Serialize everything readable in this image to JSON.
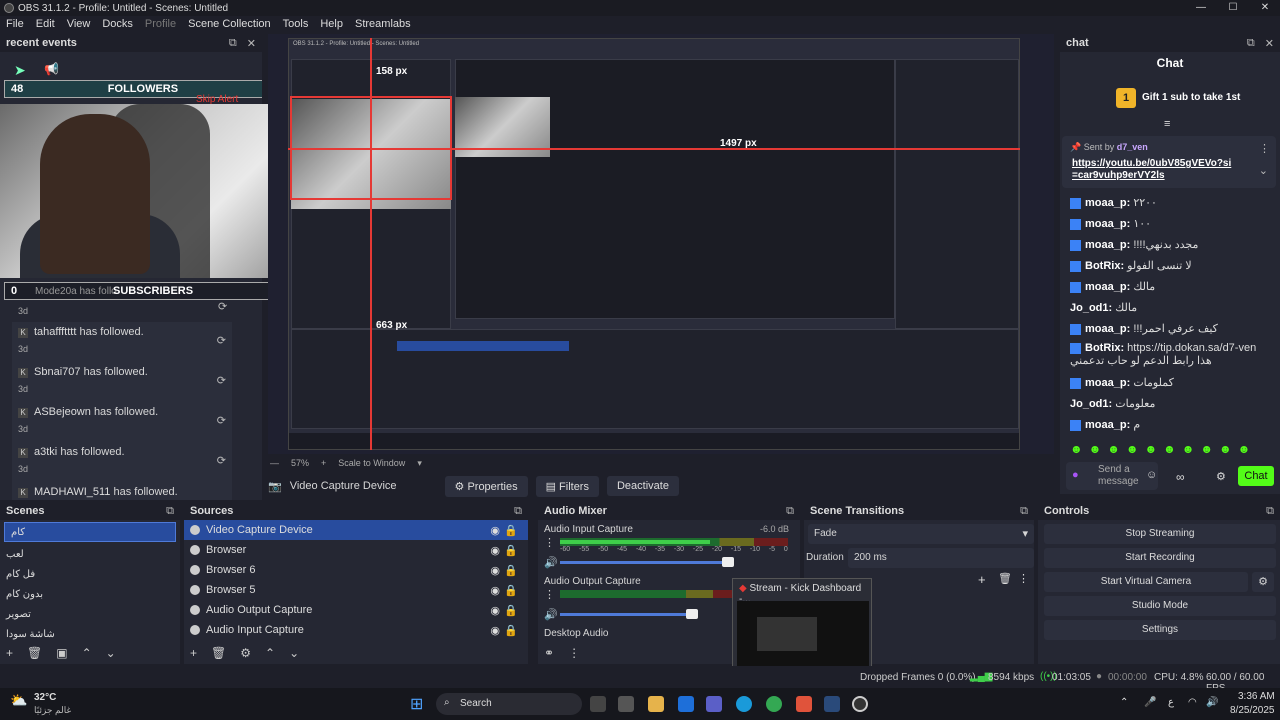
{
  "window": {
    "title": "OBS 31.1.2 - Profile: Untitled - Scenes: Untitled"
  },
  "menu": [
    "File",
    "Edit",
    "View",
    "Docks",
    "Profile",
    "Scene Collection",
    "Tools",
    "Help",
    "Streamlabs"
  ],
  "recent": {
    "title": "recent events",
    "followers_left": "48",
    "followers_label": "FOLLOWERS",
    "followers_right": "100",
    "skip_alert": "Skip Alert",
    "subs_left": "0",
    "subs_name": "Mode20a",
    "subs_partial": "has follo",
    "subs_label": "SUBSCRIBERS",
    "subs_right": "10",
    "events": [
      {
        "name": "tahaffftttt",
        "text": "has followed.",
        "when": "3d"
      },
      {
        "name": "Sbnai707",
        "text": "has followed.",
        "when": "3d"
      },
      {
        "name": "ASBejeown",
        "text": "has followed.",
        "when": "3d"
      },
      {
        "name": "a3tki",
        "text": "has followed.",
        "when": "3d"
      },
      {
        "name": "MADHAWI_511",
        "text": "has followed.",
        "when": ""
      }
    ],
    "first_when": "3d"
  },
  "preview": {
    "nested_title": "OBS 31.1.2 - Profile: Untitled - Scenes: Untitled",
    "measure_1": "158 px",
    "measure_2": "1497 px",
    "measure_3": "663 px",
    "zoom": "57%",
    "zoom_mode": "Scale to Window"
  },
  "chat": {
    "title": "chat",
    "header": "Chat",
    "goal_number": "1",
    "goal": "Gift 1 sub to take 1st",
    "pinned_by": "Sent by",
    "pinned_user": "d7_ven",
    "pinned_link": "https://youtu.be/0ubV85gVEVo?si=car9vuhp9erVY2ls",
    "messages": [
      {
        "user": "moaa_p:",
        "text": "٢٢٠٠"
      },
      {
        "user": "moaa_p:",
        "text": "١٠٠"
      },
      {
        "user": "moaa_p:",
        "text": "!!!!مجدد بدنهي"
      },
      {
        "user": "BotRix:",
        "text": "لا تنسى الفولو"
      },
      {
        "user": "moaa_p:",
        "text": "مالك"
      },
      {
        "user": "Jo_od1:",
        "text": "مالك"
      },
      {
        "user": "moaa_p:",
        "text": "!!!كيف عرفي احمر"
      },
      {
        "user": "BotRix:",
        "text": "https://tip.dokan.sa/d7-ven هذا رابط الدعم لو حاب تدعمني"
      },
      {
        "user": "moaa_p:",
        "text": "كملومات"
      },
      {
        "user": "Jo_od1:",
        "text": "معلومات"
      },
      {
        "user": "moaa_p:",
        "text": "م"
      }
    ],
    "send_placeholder": "Send a message",
    "send_button": "Chat"
  },
  "source_toolbar": {
    "source": "Video Capture Device",
    "properties": "Properties",
    "filters": "Filters",
    "deactivate": "Deactivate"
  },
  "scenes": {
    "title": "Scenes",
    "items": [
      "كام",
      "لعب",
      "فل كام",
      "بدون كام",
      "تصوير",
      "شاشة سودا"
    ]
  },
  "sources": {
    "title": "Sources",
    "items": [
      "Video Capture Device",
      "Browser",
      "Browser 6",
      "Browser 5",
      "Audio Output Capture",
      "Audio Input Capture"
    ]
  },
  "mixer": {
    "title": "Audio Mixer",
    "ch1": "Audio Input Capture",
    "ch1_db": "-6.0 dB",
    "ch2": "Audio Output Capture",
    "ch3": "Desktop Audio",
    "ticks": [
      "-60",
      "-55",
      "-50",
      "-45",
      "-40",
      "-35",
      "-30",
      "-25",
      "-20",
      "-15",
      "-10",
      "-5",
      "0"
    ]
  },
  "transitions": {
    "title": "Scene Transitions",
    "type": "Fade",
    "duration_label": "Duration",
    "duration": "200 ms"
  },
  "controls": {
    "title": "Controls",
    "buttons": [
      "Stop Streaming",
      "Start Recording",
      "Start Virtual Camera",
      "Studio Mode",
      "Settings"
    ]
  },
  "popup": {
    "title": "Stream - Kick Dashboard -..."
  },
  "status": {
    "dropped": "Dropped Frames 0 (0.0%)",
    "bitrate": "8594 kbps",
    "stream_time": "01:03:05",
    "rec_time": "00:00:00",
    "cpu": "CPU: 4.8%",
    "fps": "60.00 / 60.00 FPS"
  },
  "taskbar": {
    "weather_temp": "32°C",
    "weather_desc": "غالم جزئيًا",
    "search": "Search",
    "time": "3:36 AM",
    "date": "8/25/2025",
    "lang": "ع"
  },
  "colors": {
    "accent": "#53fc18",
    "selection": "#284c9e",
    "danger": "#e53935"
  }
}
